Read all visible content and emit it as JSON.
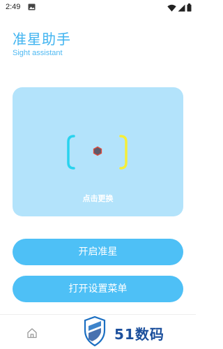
{
  "status_bar": {
    "time": "2:49",
    "icons": [
      "image-icon",
      "wifi-icon",
      "signal-icon",
      "battery-icon"
    ]
  },
  "header": {
    "title": "准星助手",
    "subtitle": "Sight assistant"
  },
  "sight_card": {
    "change_label": "点击更换",
    "colors": {
      "card": "#b3e3fb",
      "left_bracket": "#29d3ee",
      "right_bracket": "#f5ee3a",
      "dot_fill": "#5e5a6a",
      "dot_border": "#e24b3b"
    }
  },
  "buttons": {
    "start_sight": "开启准星",
    "open_settings": "打开设置菜单"
  },
  "bottom_nav": {
    "items": [
      "home-icon"
    ],
    "watermark_text": "51数码"
  },
  "colors": {
    "accent": "#3fb3f0",
    "button": "#4ec0f6"
  }
}
